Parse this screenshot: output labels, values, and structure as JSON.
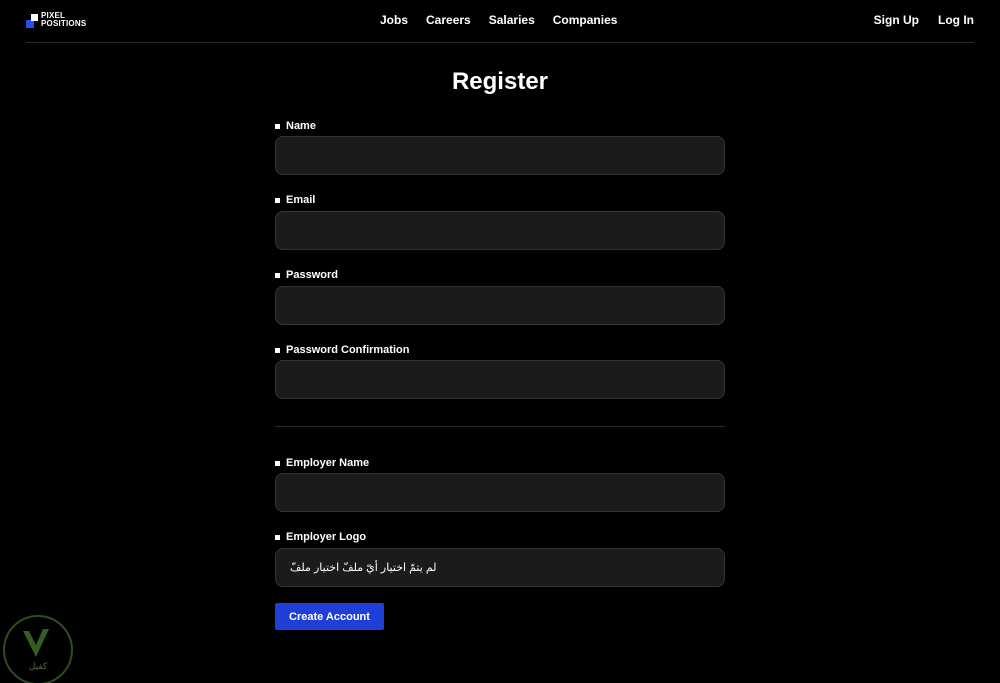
{
  "header": {
    "logo_lines": [
      "PIXEL",
      "POSITIONS"
    ],
    "nav": [
      "Jobs",
      "Careers",
      "Salaries",
      "Companies"
    ],
    "auth": [
      "Sign Up",
      "Log In"
    ]
  },
  "page_title": "Register",
  "form": {
    "name_label": "Name",
    "email_label": "Email",
    "password_label": "Password",
    "password_confirmation_label": "Password Confirmation",
    "employer_name_label": "Employer Name",
    "employer_logo_label": "Employer Logo",
    "file_input_text": "لم يتمّ اختيار أيّ ملفّ اختيار ملفّ",
    "submit_label": "Create Account"
  },
  "watermark": {
    "text": "كفيل"
  },
  "colors": {
    "background": "#000000",
    "input_bg": "#1b1b1b",
    "button": "#1f3fd6",
    "logo_blue": "#2b4cf0"
  }
}
